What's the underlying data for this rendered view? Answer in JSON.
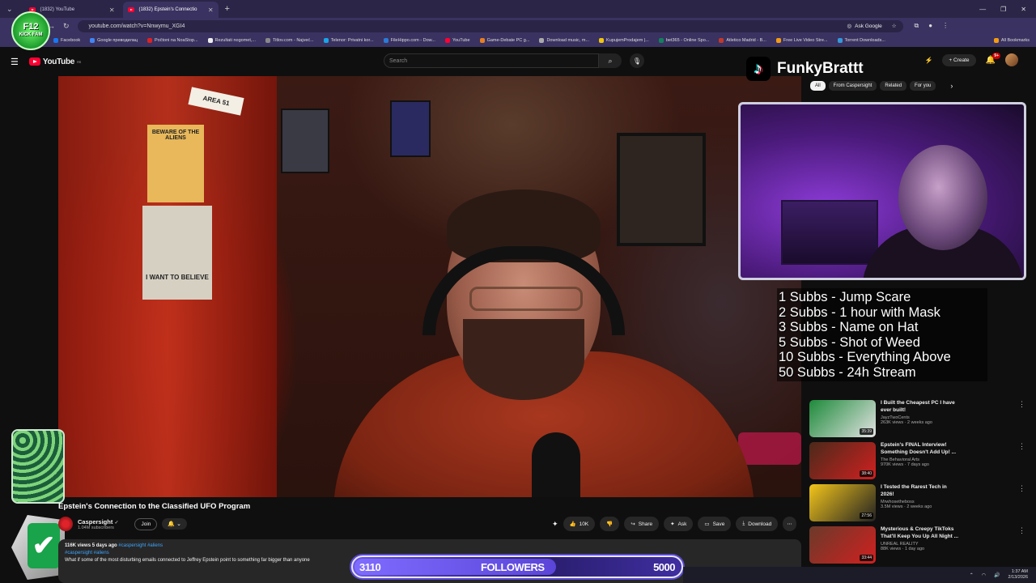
{
  "browser": {
    "tabs": [
      {
        "label": "(1832) YouTube",
        "active": false
      },
      {
        "label": "(1832) Epstein's Connectio",
        "active": true
      }
    ],
    "url": "youtube.com/watch?v=Nnwymu_XGI4",
    "ask_google": "Ask Google",
    "bookmarks": [
      "Facebook",
      "Google преводилац",
      "Počtoni na NoaStop...",
      "Rezultati nogomet,...",
      "Titlov.com - Najveć...",
      "Telenor: Privatni kor...",
      "FileHippo.com - Dow...",
      "YouTube",
      "Game-Debate PC g...",
      "Download music, m...",
      "KupujemProdajem |...",
      "bet365 - Online Spo...",
      "Atletico Madrid - B...",
      "Free Live Video Stre...",
      "Torrent Downloads..."
    ],
    "all_bookmarks": "All Bookmarks"
  },
  "youtube": {
    "logo_text": "YouTube",
    "logo_country": "RS",
    "search_placeholder": "Search",
    "create_label": "Create",
    "notification_count": "9+"
  },
  "overlay": {
    "kick_logo": "F12",
    "kick_logo_sub": "KICK FAM",
    "tiktok_user": "FunkyBrattt",
    "sub_goals": [
      "1 Subbs - Jump Scare",
      "2 Subbs - 1 hour with Mask",
      "3 Subbs - Name on Hat",
      "5 Subbs - Shot of Weed",
      "10 Subbs - Everything Above",
      "50 Subbs - 24h Stream"
    ],
    "followers": {
      "current": "3110",
      "label": "FOLLOWERS",
      "goal": "5000",
      "progress": 0.622
    }
  },
  "video": {
    "title": "Epstein's Connection to the Classified UFO Program",
    "poster_text_1": "BEWARE OF THE ALIENS",
    "poster_text_2": "I WANT TO BELIEVE",
    "sign_text": "AREA 51"
  },
  "channel": {
    "name": "Caspersight",
    "subscribers": "1.04M subscribers",
    "join_label": "Join"
  },
  "actions": {
    "likes": "10K",
    "share": "Share",
    "ask": "Ask",
    "save": "Save",
    "download": "Download"
  },
  "description": {
    "meta": "116K views  5 days ago",
    "meta_tags": "#caspersight #aliens",
    "tags": "#caspersight #aliens",
    "text": "What if some of the most disturbing emails connected to Jeffrey Epstein point to something far bigger than anyone"
  },
  "filter_chips": [
    "All",
    "From Caspersight",
    "Related",
    "For you"
  ],
  "sidebar": [
    {
      "title": "I Built the Cheapest PC I have ever built!",
      "channel": "JayzTwoCents",
      "views": "263K views · 2 weeks ago",
      "duration": "35:39",
      "color1": "#1d8a3a",
      "color2": "#e3e3e3"
    },
    {
      "title": "Epstein's FINAL Interview! Something Doesn't Add Up! ...",
      "channel": "The Behavioral Arts",
      "views": "970K views · 7 days ago",
      "duration": "38:40",
      "color1": "#4a2a1a",
      "color2": "#d02020"
    },
    {
      "title": "I Tested the Rarest Tech in 2026!",
      "channel": "Mrwhosetheboss",
      "views": "3.5M views · 2 weeks ago",
      "duration": "27:56",
      "color1": "#f3c51a",
      "color2": "#222"
    },
    {
      "title": "Mysterious & Creepy TikToks That'll Keep You Up All Night ...",
      "channel": "UNREAL REALITY",
      "views": "88K views · 1 day ago",
      "duration": "33:44",
      "color1": "#6a3a2a",
      "color2": "#d12020"
    }
  ],
  "taskbar": {
    "time": "1:37 AM",
    "date": "2/13/2026"
  }
}
